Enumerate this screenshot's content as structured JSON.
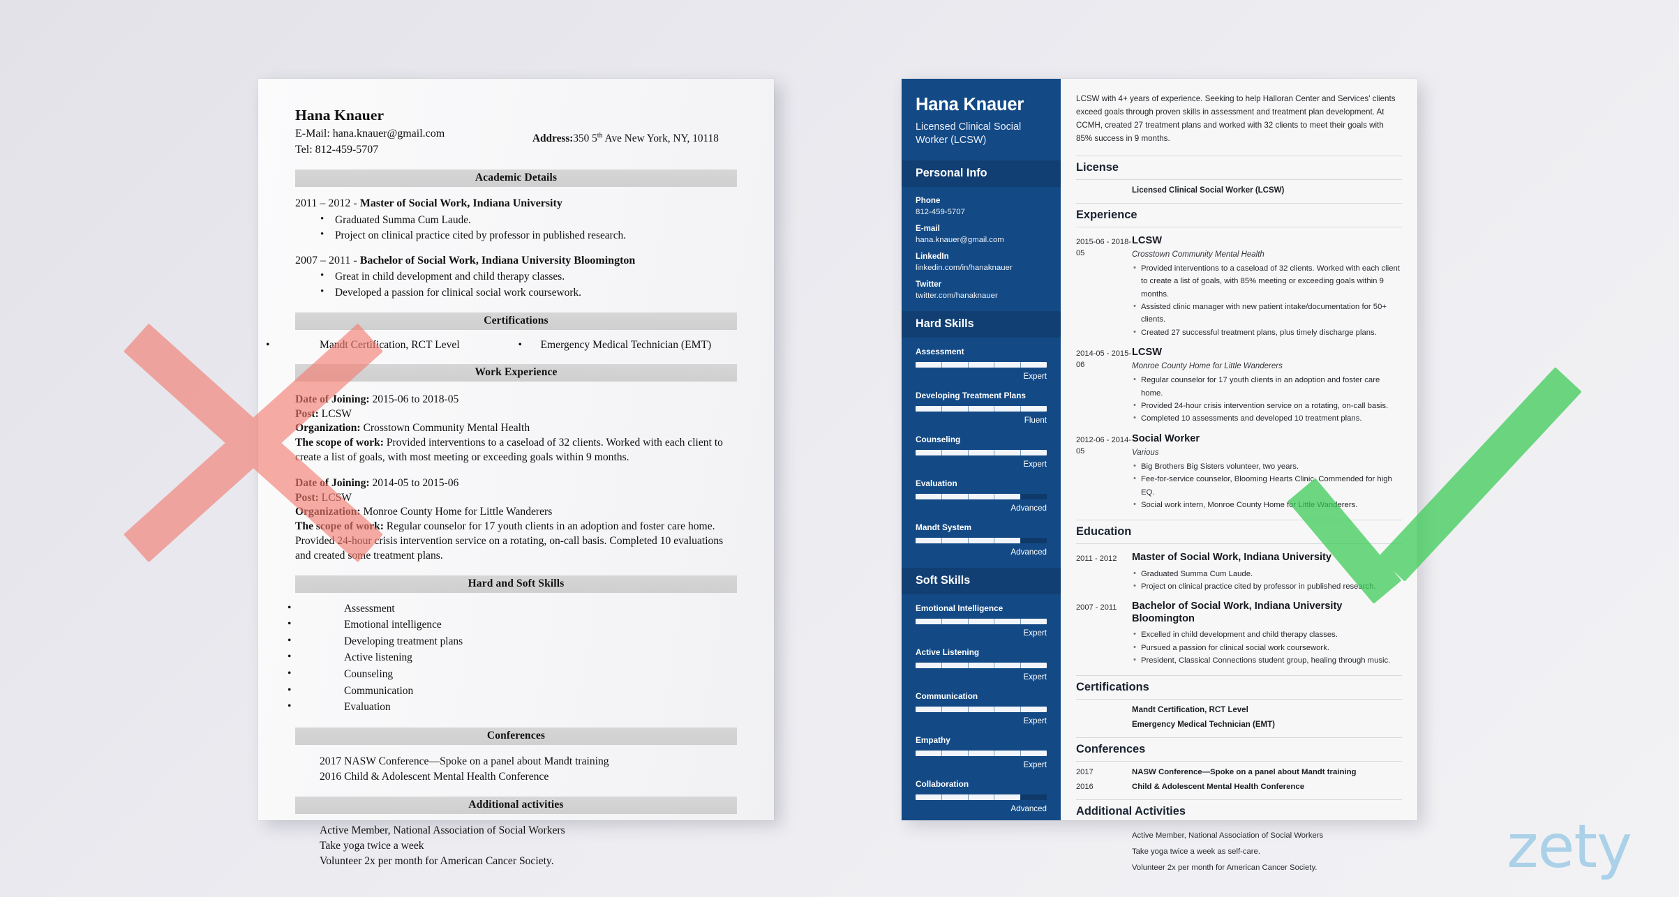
{
  "bad_resume": {
    "name": "Hana Knauer",
    "email_line": "E-Mail: hana.knauer@gmail.com",
    "tel_line": "Tel: 812-459-5707",
    "address_label": "Address:",
    "address_value_pre": "350 5",
    "address_sup": "th",
    "address_value_post": " Ave New York, NY, 10118",
    "sections": {
      "academic": "Academic Details",
      "certifications": "Certifications",
      "work": "Work Experience",
      "skills": "Hard and Soft Skills",
      "conferences": "Conferences",
      "additional": "Additional activities"
    },
    "education": [
      {
        "heading_years": "2011 – 2012 - ",
        "heading_bold": "Master of Social Work, Indiana University",
        "bullets": [
          "Graduated Summa Cum Laude.",
          "Project on clinical practice cited by professor in published research."
        ]
      },
      {
        "heading_years": "2007 – 2011 - ",
        "heading_bold": "Bachelor of Social Work, Indiana University Bloomington",
        "bullets": [
          "Great in child development and child therapy classes.",
          "Developed a passion for clinical social work coursework."
        ]
      }
    ],
    "certifications": [
      "Mandt Certification, RCT Level",
      "Emergency Medical Technician (EMT)"
    ],
    "jobs": [
      {
        "date_label": "Date of Joining:",
        "date_value": " 2015-06 to 2018-05",
        "post_label": "Post:",
        "post_value": " LCSW",
        "org_label": "Organization:",
        "org_value": " Crosstown Community Mental Health",
        "scope_label": "The scope of work:",
        "scope_value": " Provided interventions to a caseload of 32 clients. Worked with each client to create a list of goals, with most meeting or exceeding goals within 9 months."
      },
      {
        "date_label": "Date of Joining:",
        "date_value": " 2014-05 to 2015-06",
        "post_label": "Post:",
        "post_value": " LCSW",
        "org_label": "Organization:",
        "org_value": " Monroe County Home for Little Wanderers",
        "scope_label": "The scope of work:",
        "scope_value": " Regular counselor for 17 youth clients in an adoption and foster care home. Provided 24-hour crisis intervention service on a rotating, on-call basis. Completed 10 evaluations and created some treatment plans."
      }
    ],
    "skills": [
      "Assessment",
      "Emotional intelligence",
      "Developing treatment plans",
      "Active listening",
      "Counseling",
      "Communication",
      "Evaluation"
    ],
    "conferences": [
      "2017 NASW Conference—Spoke on a panel about Mandt training",
      "2016 Child & Adolescent Mental Health Conference"
    ],
    "additional": [
      "Active Member, National Association of Social Workers",
      "Take yoga twice a week",
      "Volunteer 2x per month for American Cancer Society."
    ]
  },
  "good_resume": {
    "sidebar": {
      "name": "Hana Knauer",
      "title": "Licensed Clinical Social Worker (LCSW)",
      "personal_info_heading": "Personal Info",
      "personal_info": [
        {
          "label": "Phone",
          "value": "812-459-5707"
        },
        {
          "label": "E-mail",
          "value": "hana.knauer@gmail.com"
        },
        {
          "label": "LinkedIn",
          "value": "linkedin.com/in/hanaknauer"
        },
        {
          "label": "Twitter",
          "value": "twitter.com/hanaknauer"
        }
      ],
      "hard_skills_heading": "Hard Skills",
      "hard_skills": [
        {
          "name": "Assessment",
          "level": "Expert",
          "pct": 100
        },
        {
          "name": "Developing Treatment Plans",
          "level": "Fluent",
          "pct": 100
        },
        {
          "name": "Counseling",
          "level": "Expert",
          "pct": 100
        },
        {
          "name": "Evaluation",
          "level": "Advanced",
          "pct": 80
        },
        {
          "name": "Mandt System",
          "level": "Advanced",
          "pct": 80
        }
      ],
      "soft_skills_heading": "Soft Skills",
      "soft_skills": [
        {
          "name": "Emotional Intelligence",
          "level": "Expert",
          "pct": 100
        },
        {
          "name": "Active Listening",
          "level": "Expert",
          "pct": 100
        },
        {
          "name": "Communication",
          "level": "Expert",
          "pct": 100
        },
        {
          "name": "Empathy",
          "level": "Expert",
          "pct": 100
        },
        {
          "name": "Collaboration",
          "level": "Advanced",
          "pct": 80
        }
      ]
    },
    "main": {
      "summary": "LCSW with 4+ years of experience. Seeking to help Halloran Center and Services' clients exceed goals through proven skills in assessment and treatment plan development. At CCMH, created 27 treatment plans and worked with 32 clients to meet their goals with 85% success in 9 months.",
      "license_heading": "License",
      "license_value": "Licensed Clinical Social Worker (LCSW)",
      "experience_heading": "Experience",
      "experience": [
        {
          "date": "2015-06 - 2018-05",
          "role": "LCSW",
          "org": "Crosstown Community Mental Health",
          "bullets": [
            "Provided interventions to a caseload of 32 clients. Worked with each client to create a list of goals, with 85% meeting or exceeding goals within 9 months.",
            "Assisted clinic manager with new patient intake/documentation for 50+ clients.",
            "Created 27 successful treatment plans, plus timely discharge plans."
          ]
        },
        {
          "date": "2014-05 - 2015-06",
          "role": "LCSW",
          "org": "Monroe County Home for Little Wanderers",
          "bullets": [
            "Regular counselor for 17 youth clients in an adoption and foster care home.",
            "Provided 24-hour crisis intervention service on a rotating, on-call basis.",
            "Completed 10 assessments and developed 10 treatment plans."
          ]
        },
        {
          "date": "2012-06 - 2014-05",
          "role": "Social Worker",
          "org": "Various",
          "bullets": [
            "Big Brothers Big Sisters volunteer, two years.",
            "Fee-for-service counselor, Blooming Hearts Clinic. Commended for high EQ.",
            "Social work intern, Monroe County Home for Little Wanderers."
          ]
        }
      ],
      "education_heading": "Education",
      "education": [
        {
          "date": "2011 - 2012",
          "degree": "Master of Social Work, Indiana University",
          "bullets": [
            "Graduated Summa Cum Laude.",
            "Project on clinical practice cited by professor in published research."
          ]
        },
        {
          "date": "2007 - 2011",
          "degree": "Bachelor of Social Work, Indiana University Bloomington",
          "bullets": [
            "Excelled in child development and child therapy classes.",
            "Pursued a passion for clinical social work coursework.",
            "President, Classical Connections student group, healing through music."
          ]
        }
      ],
      "certifications_heading": "Certifications",
      "certifications": [
        "Mandt Certification, RCT Level",
        "Emergency Medical Technician (EMT)"
      ],
      "conferences_heading": "Conferences",
      "conferences": [
        {
          "year": "2017",
          "text": "NASW Conference—Spoke on a panel about Mandt training"
        },
        {
          "year": "2016",
          "text": "Child & Adolescent Mental Health Conference"
        }
      ],
      "additional_heading": "Additional Activities",
      "additional": [
        "Active Member, National Association of Social Workers",
        "Take yoga twice a week as self-care.",
        "Volunteer 2x per month for American Cancer Society."
      ]
    }
  },
  "marks": {
    "x_color": "#f37a6e",
    "check_color": "#37cc52"
  },
  "watermark": {
    "text": "zety",
    "color": "#a4cfe8"
  }
}
